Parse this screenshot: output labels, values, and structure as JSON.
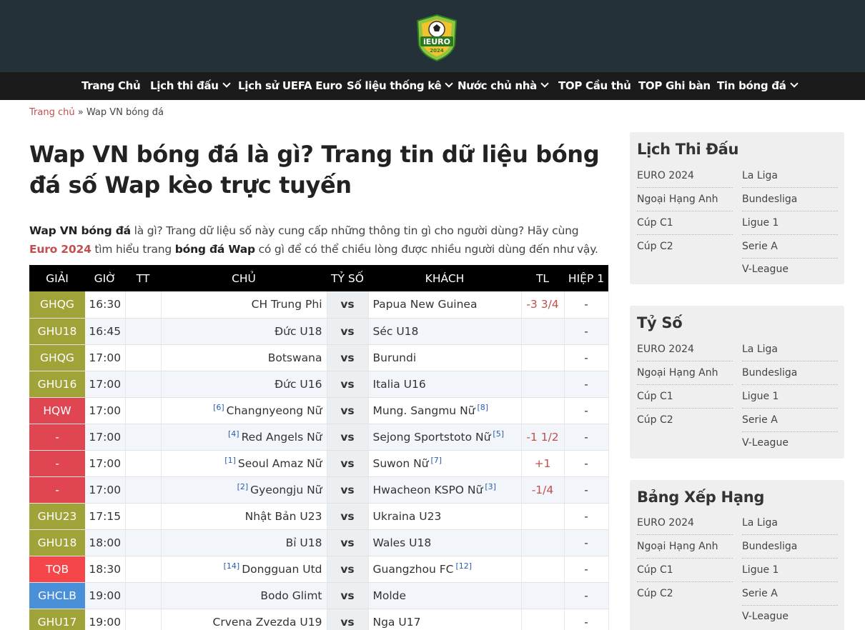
{
  "logo": {
    "text": "iEURO",
    "year": "2024"
  },
  "nav": [
    {
      "label": "Trang Chủ",
      "dropdown": false
    },
    {
      "label": "Lịch thi đấu",
      "dropdown": true
    },
    {
      "label": "Lịch sử UEFA Euro",
      "dropdown": false
    },
    {
      "label": "Số liệu thống kê",
      "dropdown": true
    },
    {
      "label": "Nước chủ nhà",
      "dropdown": true
    },
    {
      "label": "TOP Cầu thủ",
      "dropdown": false
    },
    {
      "label": "TOP Ghi bàn",
      "dropdown": false
    },
    {
      "label": "Tin bóng đá",
      "dropdown": true
    }
  ],
  "breadcrumb": {
    "home": "Trang chủ",
    "sep": "»",
    "current": "Wap VN bóng đá"
  },
  "title": "Wap VN bóng đá là gì? Trang tin dữ liệu bóng đá số Wap kèo trực tuyến",
  "intro": {
    "p1_bold": "Wap VN bóng đá",
    "p2": " là gì? Trang dữ liệu số này cung cấp những thông tin gì cho người dùng? Hãy cùng ",
    "p3_link": "Euro 2024",
    "p4": " tìm hiểu trang ",
    "p5_bold": "bóng đá Wap",
    "p6": " có gì để có thể chiều lòng được nhiều người dùng đến như vậy."
  },
  "table": {
    "headers": [
      "GIẢI",
      "GIỜ",
      "TT",
      "CHỦ",
      "TỶ SỐ",
      "KHÁCH",
      "TL",
      "HIỆP 1"
    ],
    "rows": [
      {
        "league": "GHQG",
        "color": "#a0a338",
        "time": "16:30",
        "home": "CH Trung Phi",
        "home_rank": "",
        "score": "vs",
        "away": "Papua New Guinea",
        "away_rank": "",
        "tl": "-3 3/4",
        "h1": "-"
      },
      {
        "league": "GHU18",
        "color": "#a0a338",
        "time": "16:45",
        "home": "Đức U18",
        "home_rank": "",
        "score": "vs",
        "away": "Séc U18",
        "away_rank": "",
        "tl": "",
        "h1": "-"
      },
      {
        "league": "GHQG",
        "color": "#a0a338",
        "time": "17:00",
        "home": "Botswana",
        "home_rank": "",
        "score": "vs",
        "away": "Burundi",
        "away_rank": "",
        "tl": "",
        "h1": "-"
      },
      {
        "league": "GHU16",
        "color": "#a0a338",
        "time": "17:00",
        "home": "Đức U16",
        "home_rank": "",
        "score": "vs",
        "away": "Italia U16",
        "away_rank": "",
        "tl": "",
        "h1": "-"
      },
      {
        "league": "HQW",
        "color": "#e04552",
        "time": "17:00",
        "home": "Changnyeong Nữ",
        "home_rank": "[6]",
        "score": "vs",
        "away": "Mung. Sangmu Nữ",
        "away_rank": "[8]",
        "tl": "",
        "h1": "-"
      },
      {
        "league": "-",
        "color": "#e04552",
        "time": "17:00",
        "home": "Red Angels Nữ",
        "home_rank": "[4]",
        "score": "vs",
        "away": "Sejong Sportstoto Nữ",
        "away_rank": "[5]",
        "tl": "-1 1/2",
        "h1": "-"
      },
      {
        "league": "-",
        "color": "#e04552",
        "time": "17:00",
        "home": "Seoul Amaz Nữ",
        "home_rank": "[1]",
        "score": "vs",
        "away": "Suwon Nữ",
        "away_rank": "[7]",
        "tl": "+1",
        "h1": "-"
      },
      {
        "league": "-",
        "color": "#e04552",
        "time": "17:00",
        "home": "Gyeongju Nữ",
        "home_rank": "[2]",
        "score": "vs",
        "away": "Hwacheon KSPO Nữ",
        "away_rank": "[3]",
        "tl": "-1/4",
        "h1": "-"
      },
      {
        "league": "GHU23",
        "color": "#a0a338",
        "time": "17:15",
        "home": "Nhật Bản U23",
        "home_rank": "",
        "score": "vs",
        "away": "Ukraina U23",
        "away_rank": "",
        "tl": "",
        "h1": "-"
      },
      {
        "league": "GHU18",
        "color": "#a0a338",
        "time": "18:00",
        "home": "Bỉ U18",
        "home_rank": "",
        "score": "vs",
        "away": "Wales U18",
        "away_rank": "",
        "tl": "",
        "h1": "-"
      },
      {
        "league": "TQB",
        "color": "#f5464a",
        "time": "18:30",
        "home": "Dongguan Utd",
        "home_rank": "[14]",
        "score": "vs",
        "away": "Guangzhou FC",
        "away_rank": "[12]",
        "tl": "",
        "h1": "-"
      },
      {
        "league": "GHCLB",
        "color": "#4a90d9",
        "time": "19:00",
        "home": "Bodo Glimt",
        "home_rank": "",
        "score": "vs",
        "away": "Molde",
        "away_rank": "",
        "tl": "",
        "h1": "-"
      },
      {
        "league": "GHU17",
        "color": "#a0a338",
        "time": "19:00",
        "home": "Crvena Zvezda U19",
        "home_rank": "",
        "score": "vs",
        "away": "Nga U17",
        "away_rank": "",
        "tl": "",
        "h1": "-"
      }
    ]
  },
  "sidebar": [
    {
      "title": "Lịch Thi Đấu",
      "left": [
        "EURO 2024",
        "Ngoại Hạng Anh",
        "Cúp C1",
        "Cúp C2"
      ],
      "right": [
        "La Liga",
        "Bundesliga",
        "Ligue 1",
        "Serie A",
        "V-League"
      ]
    },
    {
      "title": "Tỷ Số",
      "left": [
        "EURO 2024",
        "Ngoại Hạng Anh",
        "Cúp C1",
        "Cúp C2"
      ],
      "right": [
        "La Liga",
        "Bundesliga",
        "Ligue 1",
        "Serie A",
        "V-League"
      ]
    },
    {
      "title": "Bảng Xếp Hạng",
      "left": [
        "EURO 2024",
        "Ngoại Hạng Anh",
        "Cúp C1",
        "Cúp C2"
      ],
      "right": [
        "La Liga",
        "Bundesliga",
        "Ligue 1",
        "Serie A",
        "V-League"
      ]
    }
  ]
}
